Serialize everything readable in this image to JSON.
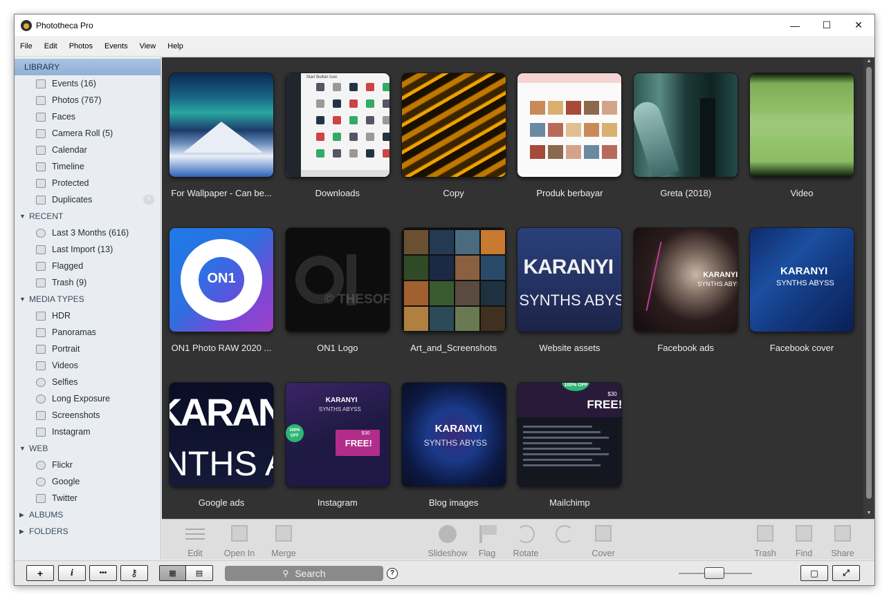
{
  "window": {
    "title": "Phototheca Pro",
    "controls": {
      "minimize": "—",
      "maximize": "☐",
      "close": "✕"
    }
  },
  "menu": [
    "File",
    "Edit",
    "Photos",
    "Events",
    "View",
    "Help"
  ],
  "sidebar": {
    "library": {
      "heading": "LIBRARY",
      "items": [
        {
          "label": "Events (16)",
          "icon": "events-icon"
        },
        {
          "label": "Photos (767)",
          "icon": "photos-icon"
        },
        {
          "label": "Faces",
          "icon": "faces-icon"
        },
        {
          "label": "Camera Roll (5)",
          "icon": "camera-roll-icon"
        },
        {
          "label": "Calendar",
          "icon": "calendar-icon"
        },
        {
          "label": "Timeline",
          "icon": "timeline-icon"
        },
        {
          "label": "Protected",
          "icon": "protected-icon"
        },
        {
          "label": "Duplicates",
          "icon": "duplicates-icon",
          "badge": "?"
        }
      ]
    },
    "recent": {
      "heading": "RECENT",
      "items": [
        {
          "label": "Last 3 Months (616)",
          "icon": "clock-icon"
        },
        {
          "label": "Last Import (13)",
          "icon": "import-icon"
        },
        {
          "label": "Flagged",
          "icon": "flag-icon"
        },
        {
          "label": "Trash (9)",
          "icon": "trash-icon"
        }
      ]
    },
    "media_types": {
      "heading": "MEDIA TYPES",
      "items": [
        {
          "label": "HDR",
          "icon": "hdr-icon"
        },
        {
          "label": "Panoramas",
          "icon": "panorama-icon"
        },
        {
          "label": "Portrait",
          "icon": "portrait-icon"
        },
        {
          "label": "Videos",
          "icon": "video-icon"
        },
        {
          "label": "Selfies",
          "icon": "selfie-icon"
        },
        {
          "label": "Long Exposure",
          "icon": "long-exposure-icon"
        },
        {
          "label": "Screenshots",
          "icon": "screenshot-icon"
        },
        {
          "label": "Instagram",
          "icon": "instagram-icon"
        }
      ]
    },
    "web": {
      "heading": "WEB",
      "items": [
        {
          "label": "Flickr",
          "icon": "flickr-icon"
        },
        {
          "label": "Google",
          "icon": "google-icon"
        },
        {
          "label": "Twitter",
          "icon": "twitter-icon"
        }
      ]
    },
    "albums": {
      "heading": "ALBUMS"
    },
    "folders": {
      "heading": "FOLDERS"
    }
  },
  "gallery": {
    "thumb_watermark": "© THESOFTWARE.SHOP",
    "thumb_text": {
      "downloads": "Start Button Icon",
      "karanyi": "KARANYI",
      "synths": "SYNTHS ABYSS",
      "free": "FREE!",
      "price": "$30",
      "off": "100% OFF"
    },
    "items": [
      {
        "label": "For Wallpaper - Can be...",
        "style": "aurora"
      },
      {
        "label": "Downloads",
        "style": "downloads"
      },
      {
        "label": "Copy",
        "style": "copy"
      },
      {
        "label": "Produk berbayar",
        "style": "produk"
      },
      {
        "label": "Greta (2018)",
        "style": "greta"
      },
      {
        "label": "Video",
        "style": "video"
      },
      {
        "label": "ON1 Photo RAW 2020 ...",
        "style": "on1"
      },
      {
        "label": "ON1 Logo",
        "style": "on1logo"
      },
      {
        "label": "Art_and_Screenshots",
        "style": "art"
      },
      {
        "label": "Website assets",
        "style": "web"
      },
      {
        "label": "Facebook ads",
        "style": "fbads"
      },
      {
        "label": "Facebook cover",
        "style": "fbcover"
      },
      {
        "label": "Google ads",
        "style": "gads"
      },
      {
        "label": "Instagram",
        "style": "insta"
      },
      {
        "label": "Blog images",
        "style": "blog"
      },
      {
        "label": "Mailchimp",
        "style": "mail"
      }
    ]
  },
  "toolbar": {
    "left": [
      {
        "label": "Edit",
        "icon": "sliders-icon"
      },
      {
        "label": "Open In",
        "icon": "open-in-icon"
      },
      {
        "label": "Merge",
        "icon": "merge-icon"
      }
    ],
    "center": [
      {
        "label": "Slideshow",
        "icon": "play-icon"
      },
      {
        "label": "Flag",
        "icon": "flag-icon"
      },
      {
        "label": "Rotate",
        "icon": "rotate-left-icon"
      },
      {
        "label": "",
        "icon": "rotate-right-icon"
      },
      {
        "label": "Cover",
        "icon": "cover-icon"
      }
    ],
    "right": [
      {
        "label": "Trash",
        "icon": "trash-icon"
      },
      {
        "label": "Find",
        "icon": "find-icon"
      },
      {
        "label": "Share",
        "icon": "share-icon"
      }
    ]
  },
  "statusbar": {
    "add": "+",
    "info": "i",
    "more": "•••",
    "key": "⚷",
    "search_placeholder": "Search",
    "help": "?"
  }
}
